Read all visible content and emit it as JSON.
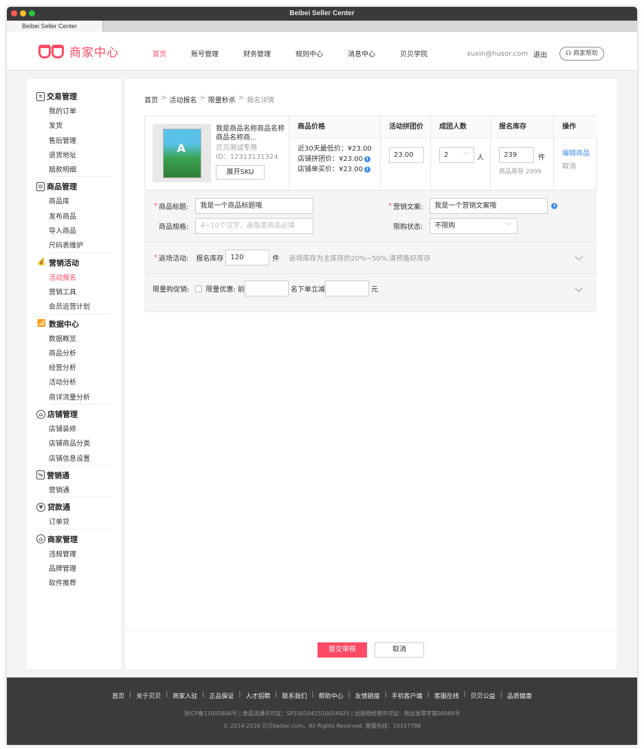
{
  "window": {
    "title": "Beibei Seller Center",
    "tab": "Beibei Seller Center",
    "lights": [
      "#fd5b56",
      "#febd2e",
      "#27c93f"
    ]
  },
  "header": {
    "logo_text": "商家中心",
    "nav": [
      "首页",
      "账号管理",
      "财务管理",
      "规则中心",
      "消息中心",
      "贝贝学院"
    ],
    "active_nav": 0,
    "user_email": "xuxin@husor.com",
    "logout": "退出",
    "help": "商家帮助"
  },
  "colors": {
    "brand": "#ff4965",
    "link": "#3d8ee8",
    "footer_bg": "#3b3b3b"
  },
  "sidebar": [
    {
      "title": "交易管理",
      "icon": "receipt-icon",
      "items": [
        "我的订单",
        "发货",
        "售后管理",
        "退货地址",
        "赔款明细"
      ]
    },
    {
      "title": "商品管理",
      "icon": "clipboard-icon",
      "items": [
        "商品库",
        "发布商品",
        "导入商品",
        "尺码表维护"
      ]
    },
    {
      "title": "营销活动",
      "icon": "money-bag-icon",
      "items": [
        "活动报名",
        "营销工具",
        "会员运营计划"
      ],
      "active": 0
    },
    {
      "title": "数据中心",
      "icon": "bar-chart-icon",
      "items": [
        "数据概览",
        "商品分析",
        "经营分析",
        "活动分析",
        "商详流量分析"
      ]
    },
    {
      "title": "店铺管理",
      "icon": "store-icon",
      "items": [
        "店铺装修",
        "店铺商品分类",
        "店铺信息设置"
      ]
    },
    {
      "title": "营销通",
      "icon": "percent-tag-icon",
      "items": [
        "营销通"
      ]
    },
    {
      "title": "贷款通",
      "icon": "yen-coin-icon",
      "items": [
        "订单贷"
      ]
    },
    {
      "title": "商家管理",
      "icon": "shop-manage-icon",
      "items": [
        "违规管理",
        "品牌管理",
        "软件推荐"
      ]
    }
  ],
  "breadcrumb": [
    "首页",
    "活动报名",
    "限量秒杀",
    "报名详情"
  ],
  "product": {
    "name": "我是商品名称商品名称商品名称商...",
    "shop": "贝贝测试专用",
    "id": "ID：12313131324",
    "sku_button": "展开SKU",
    "headers": {
      "price": "商品价格",
      "group_price": "活动拼团价",
      "group_size": "成团人数",
      "stock": "报名库存",
      "op": "操作"
    },
    "price_lines": [
      "近30天最低价：¥23.00",
      "店铺拼团价：¥23.00",
      "店铺单买价：¥23.00"
    ],
    "group_price_value": "23.00",
    "group_size_value": "2",
    "group_size_unit": "人",
    "stock_value": "239",
    "stock_unit": "件",
    "stock_total": "商品库存 2999",
    "op_edit": "编辑商品",
    "op_cancel": "取消"
  },
  "form": {
    "title_label": "商品标题:",
    "title_value": "我是一个商品标题哦",
    "copy_label": "营销文案:",
    "copy_value": "我是一个营销文案哦",
    "spec_label": "商品规格:",
    "spec_placeholder": "4~10个汉字，最瓶类商品必填",
    "limit_label": "限购状态:",
    "limit_value": "不限购",
    "return_label": "返场活动:",
    "return_stock_label": "报名库存",
    "return_stock_value": "120",
    "return_unit": "件",
    "return_hint": "返场库存为主库存的20%~50%,请预备好库存",
    "promo_label": "限量购促销:",
    "promo_checkbox": "限量优惠: 前",
    "promo_mid": "名下单立减",
    "promo_unit": "元"
  },
  "actions": {
    "submit": "提交审核",
    "cancel": "取消"
  },
  "footer": {
    "links": [
      "首页",
      "关于贝贝",
      "商家入驻",
      "正品保证",
      "人才招聘",
      "联系我们",
      "帮助中心",
      "友情链接",
      "手机客户端",
      "客服在线",
      "贝贝公益",
      "品质健康"
    ],
    "license": "浙ICP备12005806号 | 食品流通许可证：SP3301041510054925 | 出版物经营许可证：新出发零字第00086号",
    "copyright": "© 2014-2016 贝贝beibei.com。All Rights Reserved. 客服热线：10107788"
  }
}
